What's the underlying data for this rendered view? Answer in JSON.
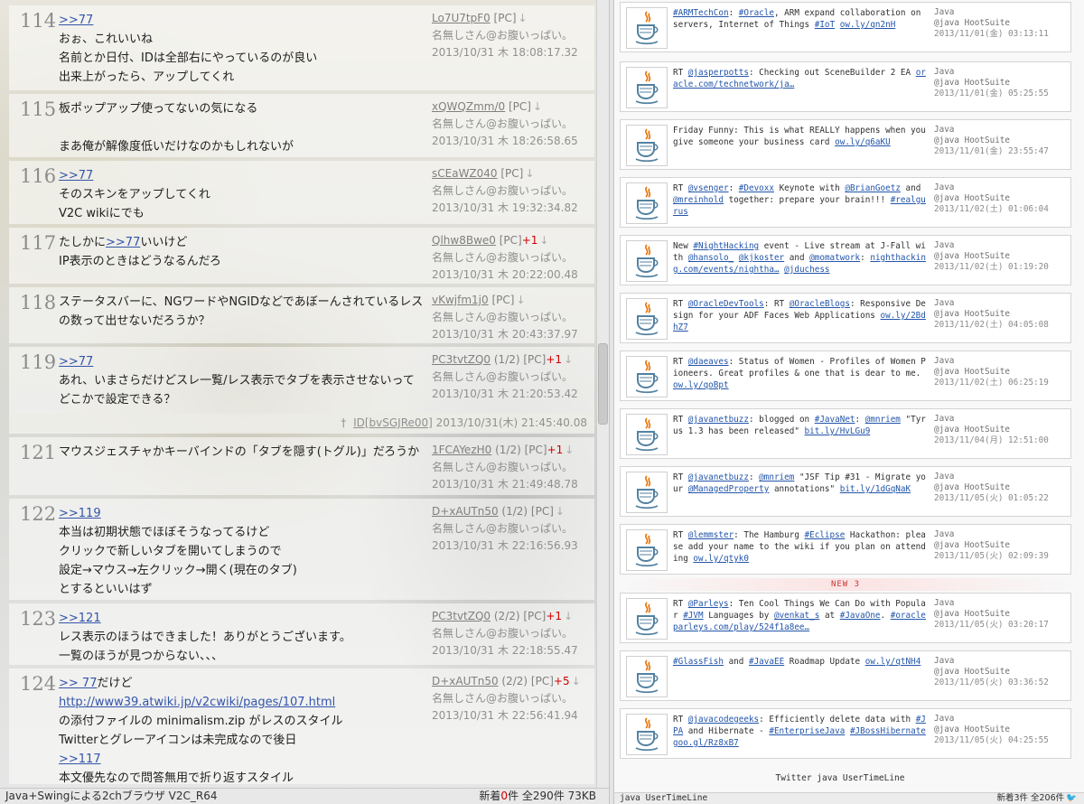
{
  "posts": [
    {
      "num": "114",
      "lines": [
        {
          "p": [
            {
              "a": ">>77"
            }
          ]
        },
        {
          "p": [
            {
              "t": "おぉ、これいいね"
            }
          ]
        },
        {
          "p": [
            {
              "t": "名前とか日付、IDは全部右にやっているのが良い"
            }
          ]
        },
        {
          "p": [
            {
              "t": "出来上がったら、アップしてくれ"
            }
          ]
        }
      ],
      "id": "Lo7U7tpF0",
      "id_suffix": " [PC]",
      "plus": "",
      "name": "名無しさん@お腹いっぱい。",
      "date": "2013/10/31 木 18:08:17.32"
    },
    {
      "num": "115",
      "lines": [
        {
          "p": [
            {
              "t": "板ポップアップ使ってないの気になる"
            }
          ]
        },
        {
          "p": [
            {
              "t": ""
            }
          ]
        },
        {
          "p": [
            {
              "t": "まあ俺が解像度低いだけなのかもしれないが"
            }
          ]
        }
      ],
      "id": "xQWQZmm/0",
      "id_suffix": " [PC]",
      "plus": "",
      "name": "名無しさん@お腹いっぱい。",
      "date": "2013/10/31 木 18:26:58.65"
    },
    {
      "num": "116",
      "lines": [
        {
          "p": [
            {
              "a": ">>77"
            }
          ]
        },
        {
          "p": [
            {
              "t": "そのスキンをアップしてくれ"
            }
          ]
        },
        {
          "p": [
            {
              "t": "V2C wikiにでも"
            }
          ]
        }
      ],
      "id": "sCEaWZ040",
      "id_suffix": " [PC]",
      "plus": "",
      "name": "名無しさん@お腹いっぱい。",
      "date": "2013/10/31 木 19:32:34.82"
    },
    {
      "num": "117",
      "lines": [
        {
          "p": [
            {
              "t": "たしかに"
            },
            {
              "a": ">>77"
            },
            {
              "t": "いいけど"
            }
          ]
        },
        {
          "p": [
            {
              "t": "IP表示のときはどうなるんだろ"
            }
          ]
        }
      ],
      "id": "Qlhw8Bwe0",
      "id_suffix": " [PC]",
      "plus": "+1",
      "name": "名無しさん@お腹いっぱい。",
      "date": "2013/10/31 木 20:22:00.48"
    },
    {
      "num": "118",
      "lines": [
        {
          "p": [
            {
              "t": "ステータスバーに、NGワードやNGIDなどであぼーんされているレス"
            }
          ]
        },
        {
          "p": [
            {
              "t": "の数って出せないだろうか？"
            }
          ]
        }
      ],
      "id": "vKwjfm1j0",
      "id_suffix": " [PC]",
      "plus": "",
      "name": "名無しさん@お腹いっぱい。",
      "date": "2013/10/31 木 20:43:37.97"
    },
    {
      "num": "119",
      "lines": [
        {
          "p": [
            {
              "a": ">>77"
            }
          ]
        },
        {
          "p": [
            {
              "t": "あれ、いまさらだけどスレ一覧/レス表示でタブを表示させないって"
            }
          ]
        },
        {
          "p": [
            {
              "t": "どこかで設定できる？"
            }
          ]
        }
      ],
      "id": "PC3tvtZQ0",
      "id_suffix": " (1/2) [PC]",
      "plus": "+1",
      "name": "名無しさん@お腹いっぱい。",
      "date": "2013/10/31 木 21:20:53.42"
    },
    {
      "num": "121",
      "lines": [
        {
          "p": [
            {
              "t": "マウスジェスチャかキーバインドの「タブを隠す(トグル)」だろうか"
            }
          ]
        }
      ],
      "id": "1FCAYezH0",
      "id_suffix": " (1/2) [PC]",
      "plus": "+1",
      "name": "名無しさん@お腹いっぱい。",
      "date": "2013/10/31 木 21:49:48.78"
    },
    {
      "num": "122",
      "lines": [
        {
          "p": [
            {
              "a": ">>119"
            }
          ]
        },
        {
          "p": [
            {
              "t": "本当は初期状態でほぼそうなってるけど"
            }
          ]
        },
        {
          "p": [
            {
              "t": "クリックで新しいタブを開いてしまうので"
            }
          ]
        },
        {
          "p": [
            {
              "t": "設定→マウス→左クリック→開く(現在のタブ)"
            }
          ]
        },
        {
          "p": [
            {
              "t": "とするといいはず"
            }
          ]
        }
      ],
      "id": "D+xAUTn50",
      "id_suffix": " (1/2) [PC]",
      "plus": "",
      "name": "名無しさん@お腹いっぱい。",
      "date": "2013/10/31 木 22:16:56.93"
    },
    {
      "num": "123",
      "lines": [
        {
          "p": [
            {
              "a": ">>121"
            }
          ]
        },
        {
          "p": [
            {
              "t": "レス表示のほうはできました！ありがとうございます。"
            }
          ]
        },
        {
          "p": [
            {
              "t": "一覧のほうが見つからない、、、"
            }
          ]
        }
      ],
      "id": "PC3tvtZQ0",
      "id_suffix": " (2/2) [PC]",
      "plus": "+1",
      "name": "名無しさん@お腹いっぱい。",
      "date": "2013/10/31 木 22:18:55.47"
    },
    {
      "num": "124",
      "lines": [
        {
          "p": [
            {
              "a": ">> 77"
            },
            {
              "t": "だけど"
            }
          ]
        },
        {
          "p": [
            {
              "a": "http://www39.atwiki.jp/v2cwiki/pages/107.html"
            }
          ]
        },
        {
          "p": [
            {
              "t": "の添付ファイルの minimalism.zip がレスのスタイル"
            }
          ]
        },
        {
          "p": [
            {
              "t": "Twitterとグレーアイコンは未完成なので後日"
            }
          ]
        },
        {
          "p": [
            {
              "a": ">>117"
            }
          ]
        },
        {
          "p": [
            {
              "t": "本文優先なので問答無用で折り返すスタイル"
            }
          ]
        }
      ],
      "id": "D+xAUTn50",
      "id_suffix": " (2/2) [PC]",
      "plus": "+5",
      "name": "名無しさん@お腹いっぱい。",
      "date": "2013/10/31 木 22:56:41.94"
    }
  ],
  "aboned": {
    "dagger": "†",
    "id": "ID[bvSGJRe00]",
    "date": "2013/10/31(木) 21:45:40.08"
  },
  "left_status": {
    "title": "Java+Swingによる2chブラウザ V2C_R64",
    "new_label": "新着",
    "new_count": "0",
    "new_unit": "件",
    "total": "全290件 73KB"
  },
  "tweets": [
    {
      "text": [
        {
          "l": "#ARMTechCon"
        },
        {
          "t": ": "
        },
        {
          "l": "#Oracle"
        },
        {
          "t": ", ARM expand collaboration on servers, Internet of Things "
        },
        {
          "l": "#IoT"
        },
        {
          "t": " "
        },
        {
          "l": "ow.ly/qn2nH"
        }
      ],
      "user": "Java",
      "handle": "@java",
      "via": "HootSuite",
      "date": "2013/11/01(金) 03:13:11"
    },
    {
      "text": [
        {
          "t": "RT "
        },
        {
          "l": "@jasperpotts"
        },
        {
          "t": ": Checking out SceneBuilder 2 EA "
        },
        {
          "l": "oracle.com/technetwork/ja…"
        }
      ],
      "user": "Java",
      "handle": "@java",
      "via": "HootSuite",
      "date": "2013/11/01(金) 05:25:55"
    },
    {
      "text": [
        {
          "t": "Friday Funny: This is what REALLY happens when you give someone your business card "
        },
        {
          "l": "ow.ly/q6aKU"
        }
      ],
      "user": "Java",
      "handle": "@java",
      "via": "HootSuite",
      "date": "2013/11/01(金) 23:55:47"
    },
    {
      "text": [
        {
          "t": "RT "
        },
        {
          "l": "@vsenger"
        },
        {
          "t": ": "
        },
        {
          "l": "#Devoxx"
        },
        {
          "t": " Keynote with "
        },
        {
          "l": "@BrianGoetz"
        },
        {
          "t": " and "
        },
        {
          "l": "@mreinhold"
        },
        {
          "t": " together: prepare your brain!!! "
        },
        {
          "l": "#realgurus"
        }
      ],
      "user": "Java",
      "handle": "@java",
      "via": "HootSuite",
      "date": "2013/11/02(土) 01:06:04"
    },
    {
      "text": [
        {
          "t": "New "
        },
        {
          "l": "#NightHacking"
        },
        {
          "t": " event - Live stream at J-Fall with "
        },
        {
          "l": "@hansolo_"
        },
        {
          "t": " "
        },
        {
          "l": "@kjkoster"
        },
        {
          "t": " and "
        },
        {
          "l": "@momatwork"
        },
        {
          "t": ": "
        },
        {
          "l": "nighthacking.com/events/nightha…"
        },
        {
          "t": " "
        },
        {
          "l": "@jduchess"
        }
      ],
      "user": "Java",
      "handle": "@java",
      "via": "HootSuite",
      "date": "2013/11/02(土) 01:19:20"
    },
    {
      "text": [
        {
          "t": "RT "
        },
        {
          "l": "@OracleDevTools"
        },
        {
          "t": ": RT "
        },
        {
          "l": "@OracleBlogs"
        },
        {
          "t": ": Responsive Design for your ADF Faces Web Applications "
        },
        {
          "l": "ow.ly/2BdhZ7"
        }
      ],
      "user": "Java",
      "handle": "@java",
      "via": "HootSuite",
      "date": "2013/11/02(土) 04:05:08"
    },
    {
      "text": [
        {
          "t": "RT "
        },
        {
          "l": "@daeaves"
        },
        {
          "t": ": Status of Women - Profiles of Women Pioneers. Great profiles & one that is dear to me. "
        },
        {
          "l": "ow.ly/qoBpt"
        }
      ],
      "user": "Java",
      "handle": "@java",
      "via": "HootSuite",
      "date": "2013/11/02(土) 06:25:19"
    },
    {
      "text": [
        {
          "t": "RT "
        },
        {
          "l": "@javanetbuzz"
        },
        {
          "t": ": blogged on "
        },
        {
          "l": "#JavaNet"
        },
        {
          "t": ": "
        },
        {
          "l": "@mnriem"
        },
        {
          "t": " \"Tyrus 1.3 has been released\" "
        },
        {
          "l": "bit.ly/HvLGu9"
        }
      ],
      "user": "Java",
      "handle": "@java",
      "via": "HootSuite",
      "date": "2013/11/04(月) 12:51:00"
    },
    {
      "text": [
        {
          "t": "RT "
        },
        {
          "l": "@javanetbuzz"
        },
        {
          "t": ": "
        },
        {
          "l": "@mnriem"
        },
        {
          "t": " \"JSF Tip #31 - Migrate your "
        },
        {
          "l": "@ManagedProperty"
        },
        {
          "t": " annotations\" "
        },
        {
          "l": "bit.ly/1dGqNaK"
        }
      ],
      "user": "Java",
      "handle": "@java",
      "via": "HootSuite",
      "date": "2013/11/05(火) 01:05:22"
    },
    {
      "text": [
        {
          "t": "RT "
        },
        {
          "l": "@lemmster"
        },
        {
          "t": ": The Hamburg  "
        },
        {
          "l": "#Eclipse"
        },
        {
          "t": " Hackathon: please add your name to the wiki if you plan on attending "
        },
        {
          "l": "ow.ly/qtyk0"
        }
      ],
      "user": "Java",
      "handle": "@java",
      "via": "HootSuite",
      "date": "2013/11/05(火) 02:09:39"
    },
    {
      "text": [
        {
          "t": "RT "
        },
        {
          "l": "@Parleys"
        },
        {
          "t": ": Ten Cool Things We Can Do with Popular "
        },
        {
          "l": "#JVM"
        },
        {
          "t": " Languages by "
        },
        {
          "l": "@venkat_s"
        },
        {
          "t": " at "
        },
        {
          "l": "#JavaOne"
        },
        {
          "t": ". "
        },
        {
          "l": "#oracle"
        },
        {
          "t": " "
        },
        {
          "l": "parleys.com/play/524f1a8ee…"
        }
      ],
      "user": "Java",
      "handle": "@java",
      "via": "HootSuite",
      "date": "2013/11/05(火) 03:20:17"
    },
    {
      "text": [
        {
          "l": "#GlassFish"
        },
        {
          "t": " and "
        },
        {
          "l": "#JavaEE"
        },
        {
          "t": " Roadmap Update "
        },
        {
          "l": "ow.ly/qtNH4"
        }
      ],
      "user": "Java",
      "handle": "@java",
      "via": "HootSuite",
      "date": "2013/11/05(火) 03:36:52"
    },
    {
      "text": [
        {
          "t": "RT "
        },
        {
          "l": "@javacodegeeks"
        },
        {
          "t": ": Efficiently delete data with "
        },
        {
          "l": "#JPA"
        },
        {
          "t": " and Hibernate - "
        },
        {
          "l": "#EnterpriseJava"
        },
        {
          "t": " "
        },
        {
          "l": "#JBossHibernate"
        },
        {
          "t": " "
        },
        {
          "l": "goo.gl/Rz8xB7"
        }
      ],
      "user": "Java",
      "handle": "@java",
      "via": "HootSuite",
      "date": "2013/11/05(火) 04:25:55"
    }
  ],
  "new_divider": "NEW 3",
  "right_footer": "Twitter java UserTimeLine",
  "right_status": {
    "title": "java UserTimeLine",
    "counts": "新着3件 全206件"
  },
  "icons": {
    "post_arrow": "down-arrow-icon",
    "avatar": "java-cup-icon",
    "bird": "twitter-bird-icon"
  },
  "colors": {
    "anchor": "#3355aa",
    "plus": "#d00000",
    "link": "#2255aa",
    "new_divider": "#cc3333"
  }
}
